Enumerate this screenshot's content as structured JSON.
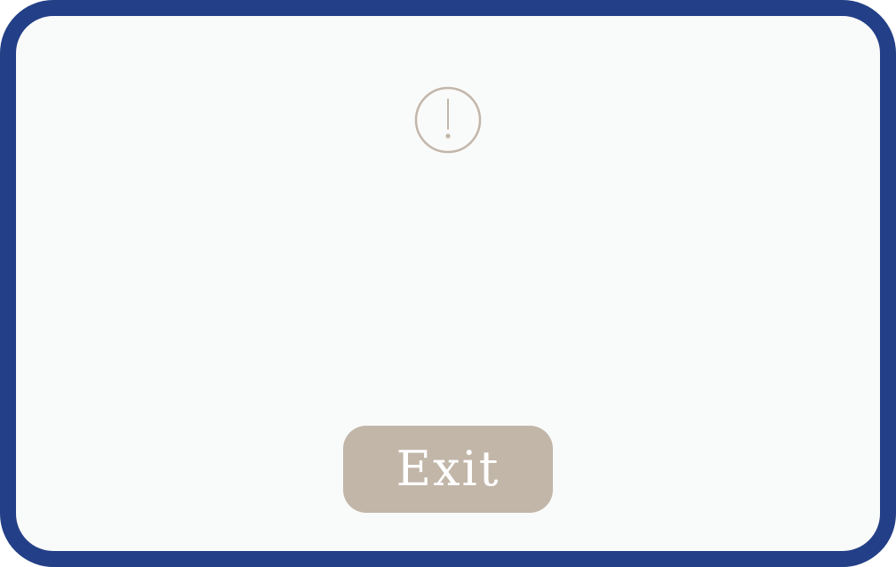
{
  "dialog": {
    "icon": "exclamation-circle-icon",
    "exit_label": "Exit"
  },
  "colors": {
    "frame_border": "#233f87",
    "background": "#f9fafa",
    "accent": "#c2b6a9",
    "button_text": "#ffffff"
  }
}
